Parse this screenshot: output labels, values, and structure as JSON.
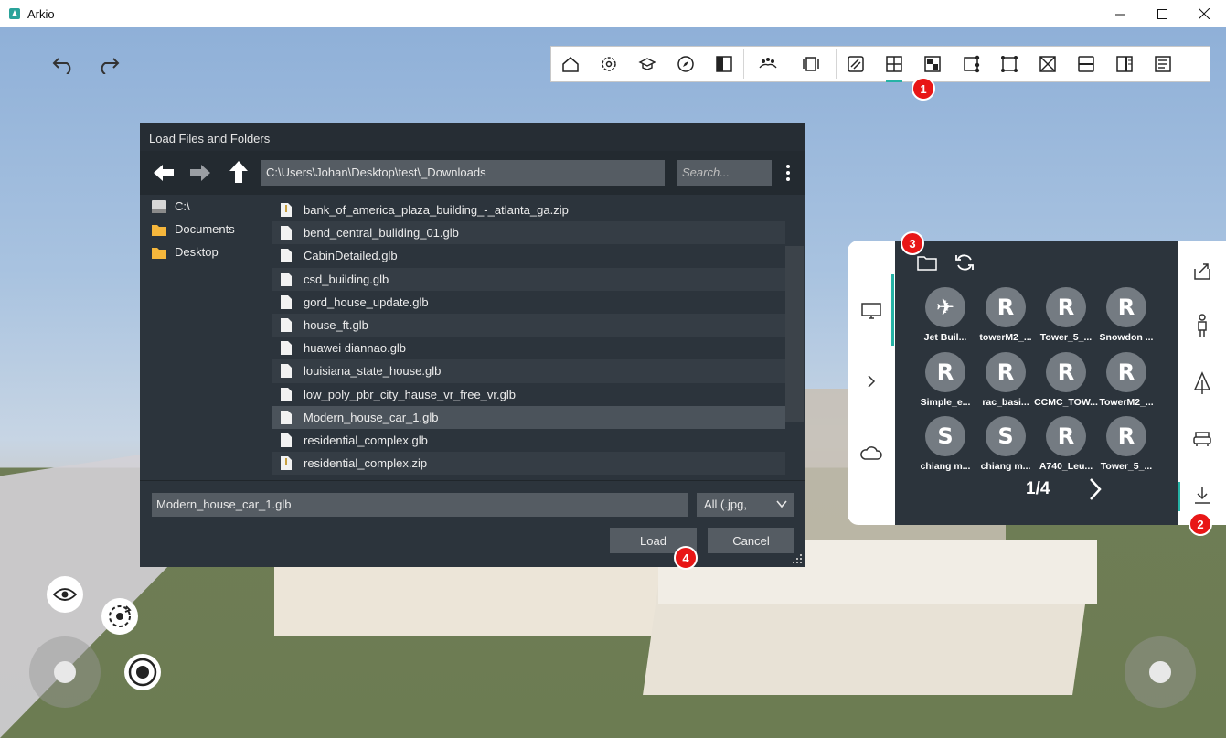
{
  "window": {
    "title": "Arkio"
  },
  "dialog": {
    "title": "Load Files and Folders",
    "path": "C:\\Users\\Johan\\Desktop\\test\\_Downloads",
    "search_placeholder": "Search...",
    "sidebar": [
      {
        "label": "C:\\",
        "icon": "drive-icon"
      },
      {
        "label": "Documents",
        "icon": "folder-icon"
      },
      {
        "label": "Desktop",
        "icon": "folder-icon"
      }
    ],
    "files": [
      {
        "name": "bank_of_america_plaza_building_-_atlanta_ga.zip",
        "icon": "zip-file-icon"
      },
      {
        "name": "bend_central_buliding_01.glb",
        "icon": "file-icon"
      },
      {
        "name": "CabinDetailed.glb",
        "icon": "file-icon"
      },
      {
        "name": "csd_building.glb",
        "icon": "file-icon"
      },
      {
        "name": "gord_house_update.glb",
        "icon": "file-icon"
      },
      {
        "name": "house_ft.glb",
        "icon": "file-icon"
      },
      {
        "name": "huawei diannao.glb",
        "icon": "file-icon"
      },
      {
        "name": "louisiana_state_house.glb",
        "icon": "file-icon"
      },
      {
        "name": "low_poly_pbr_city_hause_vr_free_vr.glb",
        "icon": "file-icon"
      },
      {
        "name": "Modern_house_car_1.glb",
        "icon": "file-icon",
        "selected": true
      },
      {
        "name": "residential_complex.glb",
        "icon": "file-icon"
      },
      {
        "name": "residential_complex.zip",
        "icon": "zip-file-icon"
      }
    ],
    "filename_value": "Modern_house_car_1.glb",
    "filter_value": "All (.jpg,",
    "load_label": "Load",
    "cancel_label": "Cancel"
  },
  "panel": {
    "tiles": [
      {
        "label": "Jet Buil...",
        "glyph": "✈"
      },
      {
        "label": "towerM2_...",
        "glyph": "R"
      },
      {
        "label": "Tower_5_...",
        "glyph": "R"
      },
      {
        "label": "Snowdon ...",
        "glyph": "R"
      },
      {
        "label": "Simple_e...",
        "glyph": "R"
      },
      {
        "label": "rac_basi...",
        "glyph": "R"
      },
      {
        "label": "CCMC_TOW...",
        "glyph": "R"
      },
      {
        "label": "TowerM2_...",
        "glyph": "R"
      },
      {
        "label": "chiang m...",
        "glyph": "S"
      },
      {
        "label": "chiang m...",
        "glyph": "S"
      },
      {
        "label": "A740_Leu...",
        "glyph": "R"
      },
      {
        "label": "Tower_5_...",
        "glyph": "R"
      }
    ],
    "pager": "1/4"
  },
  "badges": [
    "1",
    "2",
    "3",
    "4"
  ],
  "colors": {
    "accent": "#26b3a6",
    "badge": "#e81616",
    "dialog_bg": "#2c343c"
  }
}
